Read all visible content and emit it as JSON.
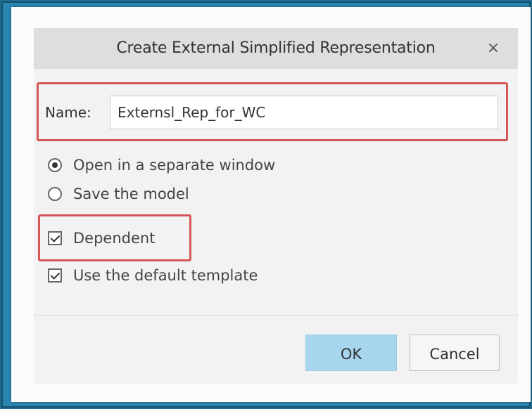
{
  "dialog": {
    "title": "Create External Simplified Representation",
    "close_glyph": "×"
  },
  "name_field": {
    "label": "Name:",
    "value": "Externsl_Rep_for_WC"
  },
  "options": {
    "open_separate_window": {
      "label": "Open in a separate window",
      "selected": true
    },
    "save_model": {
      "label": "Save the model",
      "selected": false
    },
    "dependent": {
      "label": "Dependent",
      "checked": true
    },
    "default_template": {
      "label": "Use the default template",
      "checked": true
    }
  },
  "buttons": {
    "ok_label": "OK",
    "cancel_label": "Cancel"
  },
  "colors": {
    "highlight": "#d65656",
    "ok_button": "#a9d6ef",
    "background": "#2b86b2"
  }
}
